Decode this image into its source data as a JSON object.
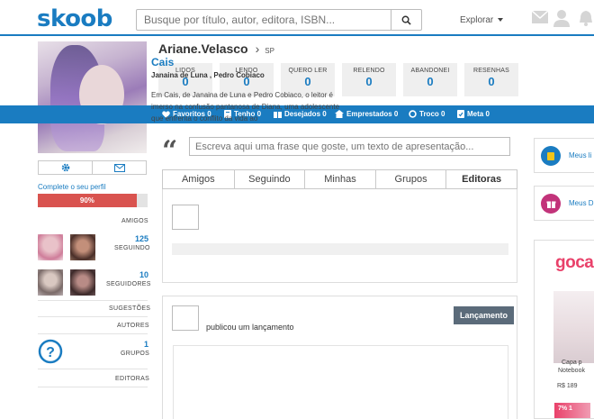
{
  "header": {
    "logo": "skoob",
    "search_placeholder": "Busque por título, autor, editora, ISBN...",
    "explore_label": "Explorar"
  },
  "profile": {
    "username": "Ariane.Velasco",
    "state": "SP",
    "stats": [
      {
        "label": "LIDOS",
        "value": "0"
      },
      {
        "label": "LENDO",
        "value": "0"
      },
      {
        "label": "QUERO LER",
        "value": "0"
      },
      {
        "label": "RELENDO",
        "value": "0"
      },
      {
        "label": "ABANDONEI",
        "value": "0"
      },
      {
        "label": "RESENHAS",
        "value": "0"
      }
    ]
  },
  "bluebar": [
    {
      "label": "Favoritos 0",
      "icon": "heart-icon"
    },
    {
      "label": "Tenho 0",
      "icon": "book-icon"
    },
    {
      "label": "Desejados 0",
      "icon": "gift-icon"
    },
    {
      "label": "Emprestados 0",
      "icon": "house-icon"
    },
    {
      "label": "Troco 0",
      "icon": "exchange-icon"
    },
    {
      "label": "Meta 0",
      "icon": "target-icon"
    }
  ],
  "sidebar": {
    "complete_profile": "Complete o seu perfil",
    "progress_label": "90%",
    "progress_value": 0.9,
    "friends_label": "AMIGOS",
    "following_count": "125",
    "following_label": "SEGUINDO",
    "followers_count": "10",
    "followers_label": "SEGUIDORES",
    "suggestions_label": "SUGESTÕES",
    "authors_label": "AUTORES",
    "groups_count": "1",
    "groups_label": "GRUPOS",
    "publishers_label": "EDITORAS"
  },
  "main": {
    "phrase_placeholder": "Escreva aqui uma frase que goste, um texto de apresentação...",
    "tabs": [
      {
        "label": "Amigos"
      },
      {
        "label": "Seguindo"
      },
      {
        "label": "Minhas"
      },
      {
        "label": "Grupos"
      },
      {
        "label": "Editoras"
      }
    ],
    "feed": {
      "published_text": "publicou um lançamento",
      "tag_label": "Lançamento",
      "book_title": "Cais",
      "book_authors": "Janaina de Luna , Pedro Cobiaco",
      "book_description": "Em Cais, de Janaina de Luna e Pedro Cobiaco, o leitor é imerso na confusão pantanosa de Diana, uma adolescente que enfrenta o conflito da vida ao"
    }
  },
  "right": {
    "card1_text": "Meus li",
    "card2_text": "Meus D",
    "ad": {
      "brand": "goca",
      "line1": "Capa p",
      "line2": "Notebook",
      "line3": "R$ 189",
      "badge": "7% 1"
    }
  },
  "colors": {
    "brand_blue": "#1a7cc1",
    "progress_red": "#d9534f",
    "tag_gray": "#5b6b7a"
  }
}
